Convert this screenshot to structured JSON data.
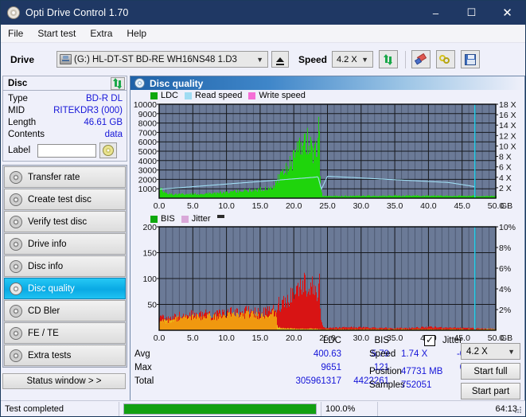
{
  "window": {
    "title": "Opti Drive Control 1.70",
    "icon": "disc-icon",
    "minimize": "–",
    "maximize": "☐",
    "close": "✕"
  },
  "menu": {
    "items": [
      "File",
      "Start test",
      "Extra",
      "Help"
    ]
  },
  "drivebar": {
    "drive_label": "Drive",
    "drive_value": "(G:)  HL-DT-ST BD-RE  WH16NS48 1.D3",
    "eject_tooltip": "Eject",
    "speed_label": "Speed",
    "speed_value": "4.2 X",
    "buttons": [
      "refresh-icon",
      "eraser-icon",
      "chain-icon",
      "save-icon"
    ]
  },
  "disc_panel": {
    "title": "Disc",
    "refresh_icon": "refresh-icon",
    "rows": [
      {
        "key": "Type",
        "value": "BD-R DL"
      },
      {
        "key": "MID",
        "value": "RITEKDR3 (000)"
      },
      {
        "key": "Length",
        "value": "46.61 GB"
      },
      {
        "key": "Contents",
        "value": "data"
      }
    ],
    "label_key": "Label",
    "label_value": "",
    "label_placeholder": ""
  },
  "nav": {
    "items": [
      {
        "label": "Transfer rate",
        "selected": false
      },
      {
        "label": "Create test disc",
        "selected": false
      },
      {
        "label": "Verify test disc",
        "selected": false
      },
      {
        "label": "Drive info",
        "selected": false
      },
      {
        "label": "Disc info",
        "selected": false
      },
      {
        "label": "Disc quality",
        "selected": true
      },
      {
        "label": "CD Bler",
        "selected": false
      },
      {
        "label": "FE / TE",
        "selected": false
      },
      {
        "label": "Extra tests",
        "selected": false
      }
    ],
    "status_window": "Status window > >"
  },
  "main": {
    "title": "Disc quality",
    "title_icon": "disc-icon"
  },
  "stats": {
    "col_ldc": "LDC",
    "col_bis": "BIS",
    "jitter_label": "Jitter",
    "jitter_checked": true,
    "rows": [
      {
        "key": "Avg",
        "ldc": "400.63",
        "bis": "5.79",
        "jitter": "-0.1%"
      },
      {
        "key": "Max",
        "ldc": "9651",
        "bis": "121",
        "jitter": "0.0%"
      },
      {
        "key": "Total",
        "ldc": "305961317",
        "bis": "4422261",
        "jitter": ""
      }
    ],
    "speed_label": "Speed",
    "speed_value": "1.74 X",
    "speed_combo": "4.2 X",
    "position_label": "Position",
    "position_value": "47731 MB",
    "samples_label": "Samples",
    "samples_value": "752051",
    "start_full": "Start full",
    "start_part": "Start part"
  },
  "statusbar": {
    "message": "Test completed",
    "progress_text": "100.0%",
    "progress_percent": 100,
    "elapsed": "64:13"
  },
  "colors": {
    "ldc_green": "#1fd40c",
    "bis_green": "#1ba31b",
    "read_speed": "#9fdcf2",
    "write_speed": "#f56fd6",
    "jitter_pink": "#d9a8d9",
    "bis_red": "#d81414",
    "bis_orange": "#f0a010",
    "bis_yellow": "#e8e018",
    "plot_bg": "#6b7a97",
    "accent_blue": "#1f3864",
    "value_blue": "#1515d8",
    "cursor_cyan": "#22d6f0"
  },
  "chart_data": [
    {
      "type": "area",
      "name": "ldc-chart",
      "title": "",
      "xlabel": "GB",
      "ylabel": "",
      "xlim": [
        0,
        50
      ],
      "ylim": [
        0,
        10000
      ],
      "y2lim": [
        0,
        18
      ],
      "y2label": "X",
      "xticks": [
        "0.0",
        "5.0",
        "10.0",
        "15.0",
        "20.0",
        "25.0",
        "30.0",
        "35.0",
        "40.0",
        "45.0",
        "50.0"
      ],
      "yticks": [
        "1000",
        "2000",
        "3000",
        "4000",
        "5000",
        "6000",
        "7000",
        "8000",
        "9000",
        "10000"
      ],
      "y2ticks": [
        "2 X",
        "4 X",
        "6 X",
        "8 X",
        "10 X",
        "12 X",
        "14 X",
        "16 X",
        "18 X"
      ],
      "grid": true,
      "legend": [
        {
          "label": "LDC",
          "color": "#1fd40c"
        },
        {
          "label": "Read speed",
          "color": "#9fdcf2"
        },
        {
          "label": "Write speed",
          "color": "#f56fd6"
        }
      ],
      "cursor_x": 46.9,
      "series": [
        {
          "name": "LDC",
          "type": "area",
          "color": "#1fd40c",
          "x": [
            0.0,
            0.6,
            1.2,
            2.0,
            3.0,
            4.0,
            5.0,
            6.0,
            7.0,
            8.0,
            9.0,
            10.0,
            11.0,
            12.0,
            13.0,
            14.0,
            15.0,
            15.8,
            16.4,
            17.0,
            17.6,
            18.2,
            18.8,
            19.4,
            20.0,
            20.6,
            21.0,
            21.4,
            21.8,
            22.0,
            22.3,
            22.6,
            22.9,
            23.1,
            23.3,
            23.5,
            23.6,
            23.7,
            23.75,
            23.8,
            23.9,
            24.2,
            25.0,
            27.0,
            30.0,
            33.0,
            36.0,
            40.0,
            44.0,
            47.0,
            48.5,
            50.0
          ],
          "values": [
            1100,
            700,
            480,
            420,
            430,
            450,
            450,
            470,
            500,
            520,
            560,
            620,
            700,
            760,
            820,
            880,
            950,
            1000,
            1150,
            1450,
            2000,
            2600,
            3200,
            3700,
            4200,
            5000,
            5600,
            6400,
            5900,
            6300,
            5000,
            5600,
            4900,
            5400,
            5000,
            6000,
            8200,
            9651,
            9200,
            5000,
            1100,
            280,
            240,
            230,
            250,
            240,
            260,
            250,
            240,
            230,
            220,
            210
          ]
        },
        {
          "name": "Read speed",
          "type": "line",
          "color": "#9fdcf2",
          "axis": "y2",
          "x": [
            0.0,
            2.0,
            5.0,
            8.0,
            11.0,
            14.0,
            17.0,
            20.0,
            23.0,
            23.6,
            24.1,
            25.0,
            28.0,
            31.0,
            34.0,
            37.0,
            40.0,
            43.0,
            46.0,
            46.9
          ],
          "values": [
            1.7,
            1.9,
            2.2,
            2.5,
            2.8,
            3.1,
            3.4,
            3.7,
            4.0,
            4.1,
            1.7,
            4.2,
            4.0,
            3.8,
            3.6,
            3.4,
            3.2,
            3.0,
            2.4,
            2.2
          ]
        }
      ]
    },
    {
      "type": "area",
      "name": "bis-chart",
      "title": "",
      "xlabel": "GB",
      "ylabel": "",
      "xlim": [
        0,
        50
      ],
      "ylim": [
        0,
        200
      ],
      "y2lim": [
        0,
        10
      ],
      "y2label": "%",
      "xticks": [
        "0.0",
        "5.0",
        "10.0",
        "15.0",
        "20.0",
        "25.0",
        "30.0",
        "35.0",
        "40.0",
        "45.0",
        "50.0"
      ],
      "yticks": [
        "50",
        "100",
        "150",
        "200"
      ],
      "y2ticks": [
        "2%",
        "4%",
        "6%",
        "8%",
        "10%"
      ],
      "grid": true,
      "legend": [
        {
          "label": "BIS",
          "color": "#1ba31b"
        },
        {
          "label": "Jitter",
          "color": "#d9a8d9"
        }
      ],
      "cursor_x": 46.9,
      "series": [
        {
          "name": "BIS",
          "type": "area",
          "color": "#d81414",
          "x": [
            0.0,
            0.5,
            1.0,
            2.0,
            3.0,
            4.0,
            5.0,
            6.0,
            7.0,
            8.0,
            9.0,
            10.0,
            11.0,
            12.0,
            13.0,
            14.0,
            15.0,
            16.0,
            16.8,
            17.2,
            17.6,
            18.0,
            18.5,
            19.0,
            19.5,
            20.0,
            20.5,
            21.0,
            21.5,
            22.0,
            22.5,
            23.0,
            23.3,
            23.5,
            23.6,
            23.7,
            23.8,
            24.0,
            24.3,
            25.0,
            28.0,
            32.0,
            36.0,
            40.0,
            44.0,
            47.0,
            48.5,
            50.0
          ],
          "values": [
            22,
            26,
            20,
            24,
            30,
            28,
            32,
            30,
            34,
            30,
            32,
            34,
            36,
            34,
            38,
            36,
            34,
            36,
            44,
            30,
            55,
            48,
            60,
            58,
            68,
            74,
            80,
            86,
            92,
            84,
            88,
            78,
            76,
            72,
            95,
            121,
            80,
            18,
            5,
            4,
            6,
            5,
            4,
            6,
            5,
            4,
            3,
            3
          ]
        },
        {
          "name": "Jitter",
          "type": "area",
          "color": "#e8c018",
          "x": [
            0.0,
            0.5,
            1.0,
            2.0,
            3.0,
            4.0,
            5.0,
            6.0,
            7.0,
            8.0,
            9.0,
            10.0,
            11.0,
            12.0,
            13.0,
            14.0,
            15.0,
            16.0,
            16.8,
            17.2,
            17.5,
            18.0,
            20.0,
            23.0,
            23.9,
            24.5,
            50.0
          ],
          "values": [
            14,
            18,
            16,
            18,
            20,
            18,
            20,
            18,
            20,
            18,
            20,
            22,
            20,
            22,
            20,
            22,
            20,
            22,
            24,
            18,
            8,
            4,
            3,
            3,
            2,
            2,
            2
          ]
        }
      ]
    }
  ]
}
